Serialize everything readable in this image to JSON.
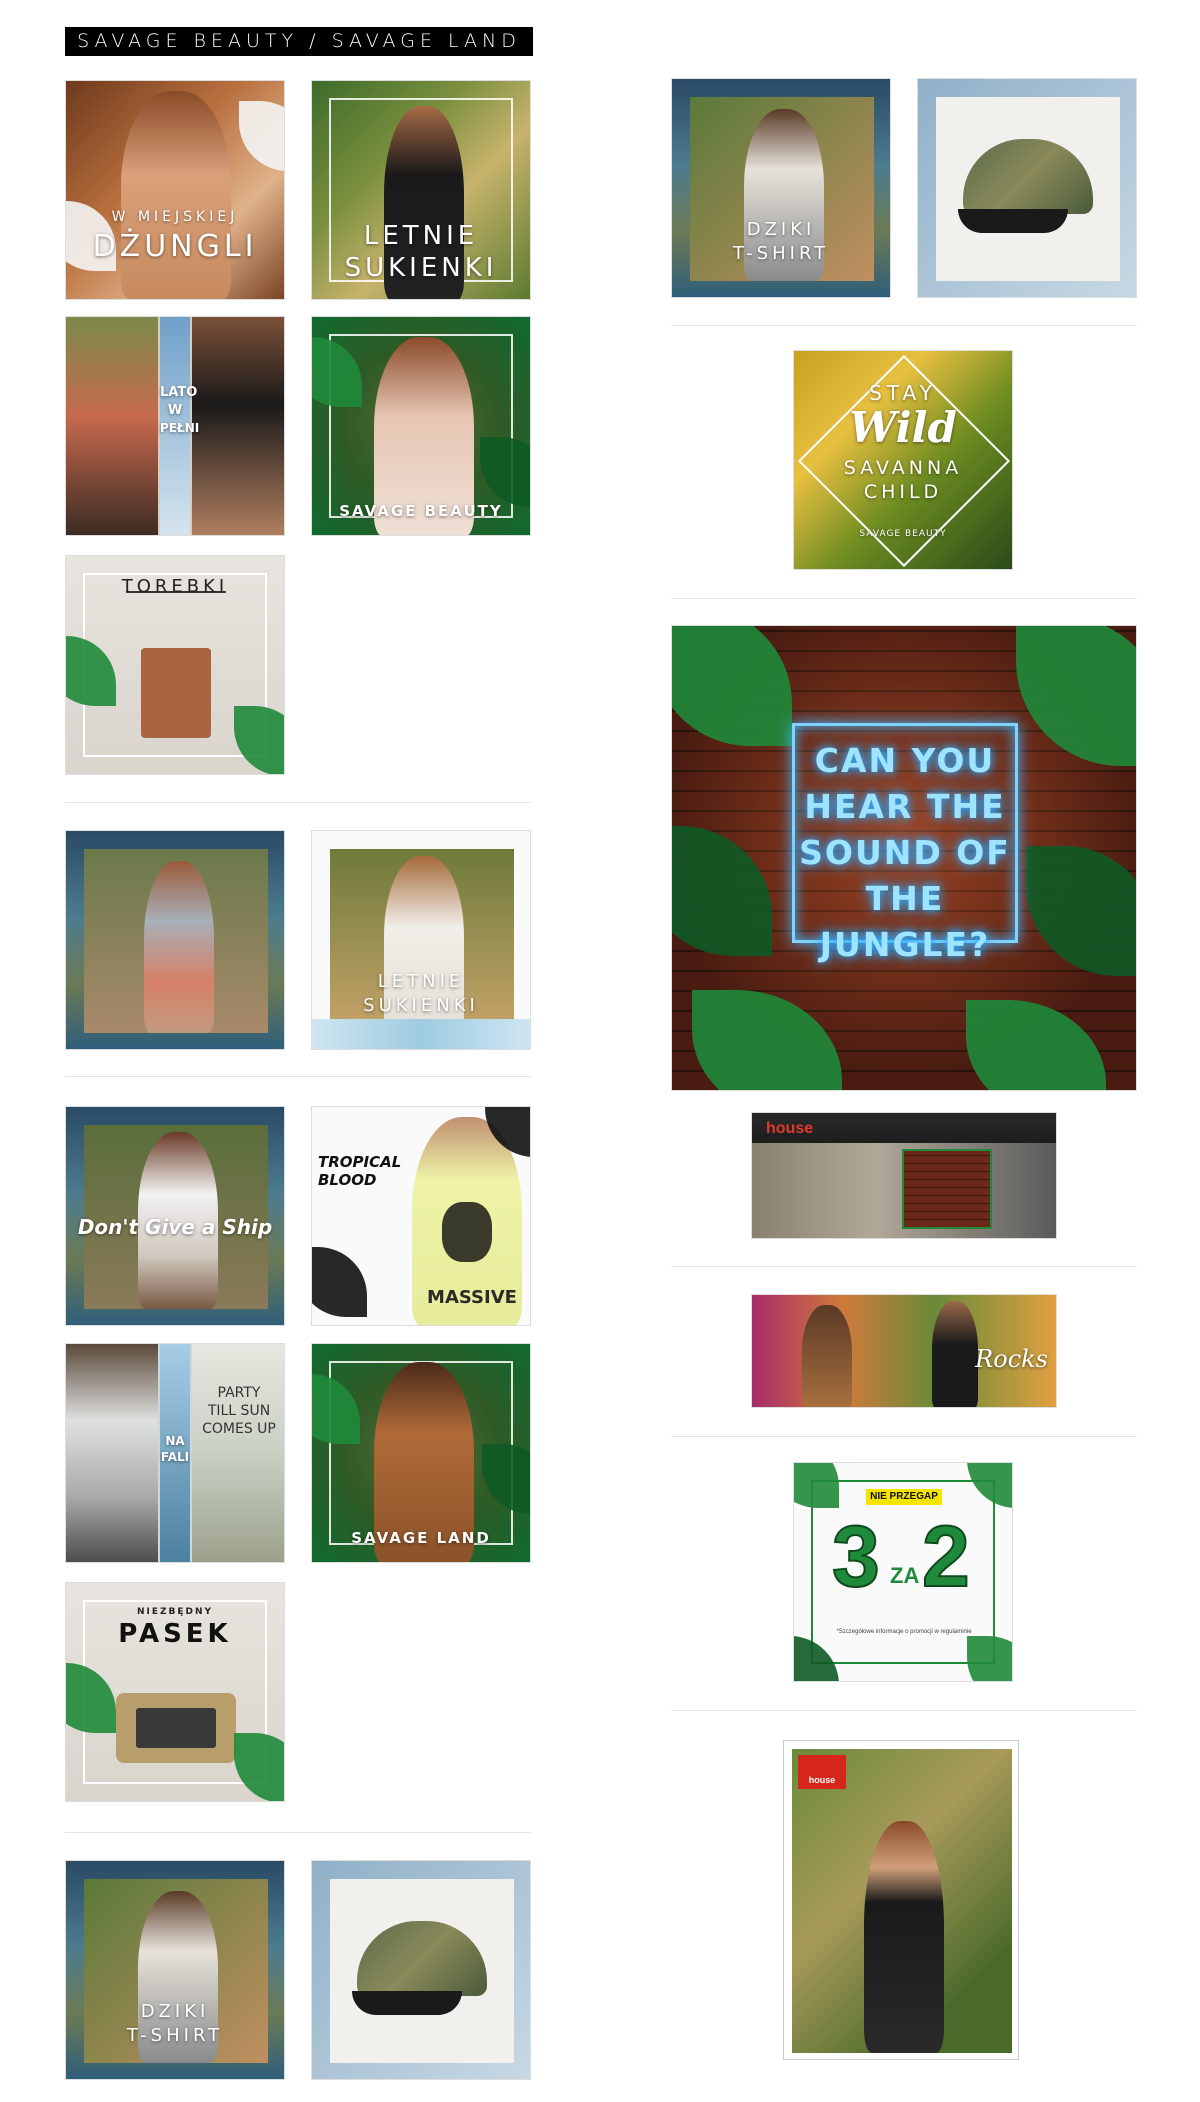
{
  "header": {
    "title": "SAVAGE BEAUTY / SAVAGE LAND"
  },
  "tiles": {
    "w_miejskiej_line1": "W MIEJSKIEJ",
    "w_miejskiej_line2": "DŻUNGLI",
    "letnie_1_line1": "LETNIE",
    "letnie_1_line2": "SUKIENKI",
    "lato_line1": "LATO",
    "lato_line2": "W",
    "lato_line3": "PEŁNI",
    "savage_beauty": "SAVAGE BEAUTY",
    "torebki": "TOREBKI",
    "letnie_2_line1": "LETNIE",
    "letnie_2_line2": "SUKIENKI",
    "dont_give": "Don't Give a Ship",
    "tropical_line1": "TROPICAL",
    "tropical_line2": "BLOOD",
    "tshirt_print": "MASSIVE",
    "na_fali_line1": "NA",
    "na_fali_line2": "FALI",
    "party_text": "PARTY TILL SUN COMES UP",
    "savage_land": "SAVAGE LAND",
    "pasek_small": "NIEZBĘDNY",
    "pasek": "PASEK",
    "dziki_line1": "DZIKI",
    "dziki_line2": "T-SHIRT",
    "stay": "STAY",
    "wild": "Wild",
    "savanna": "SAVANNA",
    "child": "CHILD",
    "savage_beauty_small": "SAVAGE BEAUTY",
    "neon_text": "CAN YOU HEAR THE SOUND OF THE JUNGLE?",
    "store_logo": "house",
    "rocks": "Rocks",
    "nie_przegap": "NIE PRZEGAP",
    "promo_3": "3",
    "promo_za": "ZA",
    "promo_2": "2",
    "promo_fine": "*Szczegółowe informacje o promocji w regulaminie",
    "poster_logo": "house"
  },
  "colors": {
    "background": "#ffffff",
    "header_bg": "#000000",
    "jungle_green": "#1f8a3a",
    "neon_blue": "#7ed4ff",
    "brick": "#7a2e1e",
    "promo_yellow": "#f5e400",
    "brand_red": "#d6251b"
  }
}
